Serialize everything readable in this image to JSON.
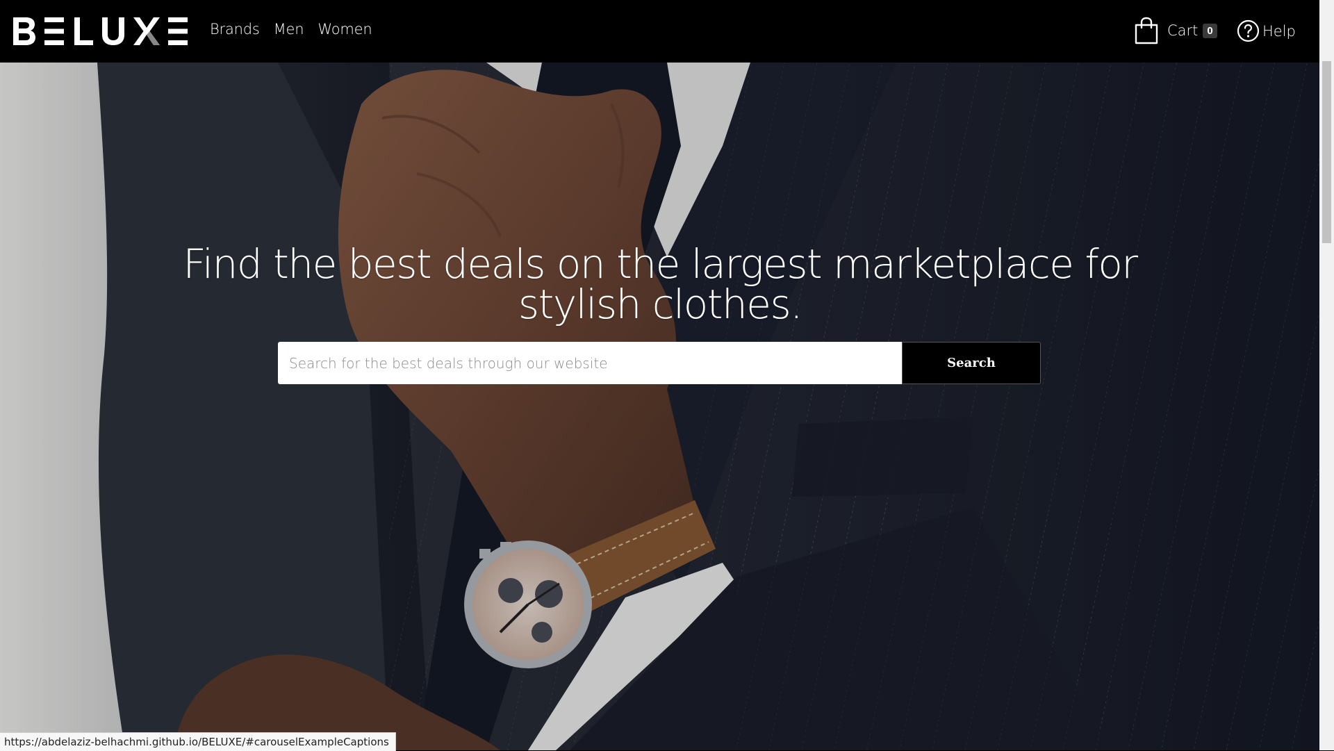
{
  "brand": {
    "name": "BELUXE"
  },
  "nav": {
    "links": [
      {
        "label": "Brands"
      },
      {
        "label": "Men"
      },
      {
        "label": "Women"
      }
    ],
    "cart": {
      "label": "Cart",
      "count": "0"
    },
    "help": {
      "label": "Help"
    }
  },
  "hero": {
    "title": "Find the best deals on the largest marketplace for stylish clothes.",
    "search": {
      "placeholder": "Search for the best deals through our website",
      "button_label": "Search"
    }
  },
  "status_bar": {
    "url": "https://abdelaziz-belhachmi.github.io/BELUXE/#carouselExampleCaptions"
  },
  "colors": {
    "nav_background": "#000000",
    "text_on_dark": "#ffffff",
    "search_button": "#000000"
  }
}
